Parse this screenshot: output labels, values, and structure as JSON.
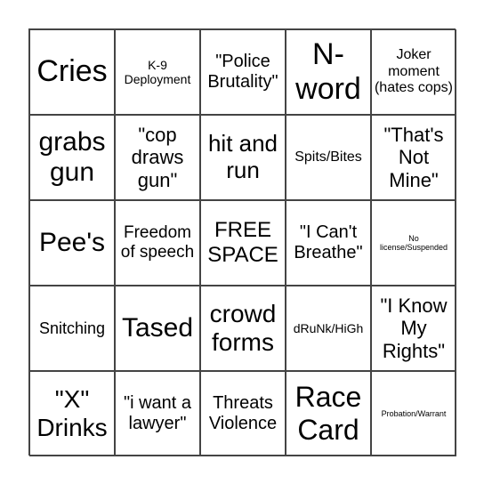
{
  "card": {
    "cells": [
      "Cries",
      "K-9 Deployment",
      "\"Police Brutality\"",
      "N-word",
      "Joker moment (hates cops)",
      "grabs gun",
      "\"cop draws gun\"",
      "hit and run",
      "Spits/Bites",
      "\"That's Not Mine\"",
      "Pee's",
      "Freedom of speech",
      "FREE SPACE",
      "\"I Can't Breathe\"",
      "No license/Suspended",
      "Snitching",
      "Tased",
      "crowd forms",
      "dRuNk/HiGh",
      "\"I Know My Rights\"",
      "\"X\" Drinks",
      "\"i want a lawyer\"",
      "Threats Violence",
      "Race Card",
      "Probation/Warrant"
    ]
  }
}
